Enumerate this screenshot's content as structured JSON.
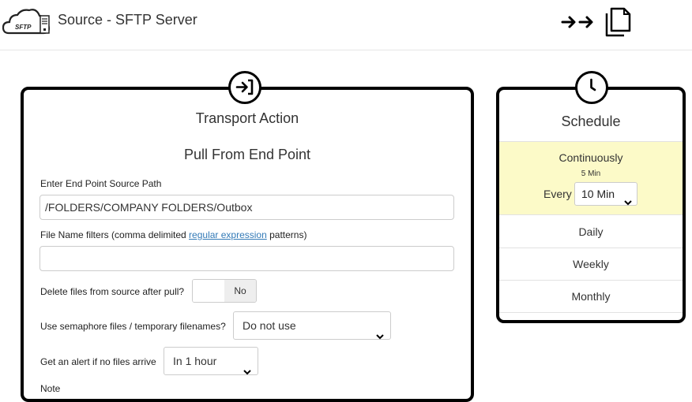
{
  "header": {
    "title": "Source - SFTP Server",
    "logo_text": "SFTP",
    "logo_icon": "sftp-cloud-server-icon",
    "transfer_icon": "double-arrow-right-icon",
    "copy_icon": "copy-files-icon"
  },
  "transport": {
    "icon": "transport-action-icon",
    "heading": "Transport Action",
    "subheading": "Pull From End Point",
    "source_path_label": "Enter End Point Source Path",
    "source_path_value": "/FOLDERS/COMPANY FOLDERS/Outbox",
    "filters_label_before": "File Name filters (comma delimited ",
    "filters_link": "regular expression",
    "filters_label_after": " patterns)",
    "filters_value": "",
    "delete_label": "Delete files from source after pull?",
    "delete_toggle_value": "No",
    "semaphore_label": "Use semaphore files / temporary filenames?",
    "semaphore_value": "Do not use",
    "alert_label": "Get an alert if no files arrive",
    "alert_value": "In 1 hour",
    "note_label": "Note"
  },
  "schedule": {
    "icon": "clock-icon",
    "heading": "Schedule",
    "continuous_label": "Continuously",
    "interval_value": "5 Min",
    "every_label": "Every",
    "every_value": "10 Min",
    "options": [
      "Daily",
      "Weekly",
      "Monthly"
    ],
    "selected_color": "#fcfac8"
  }
}
